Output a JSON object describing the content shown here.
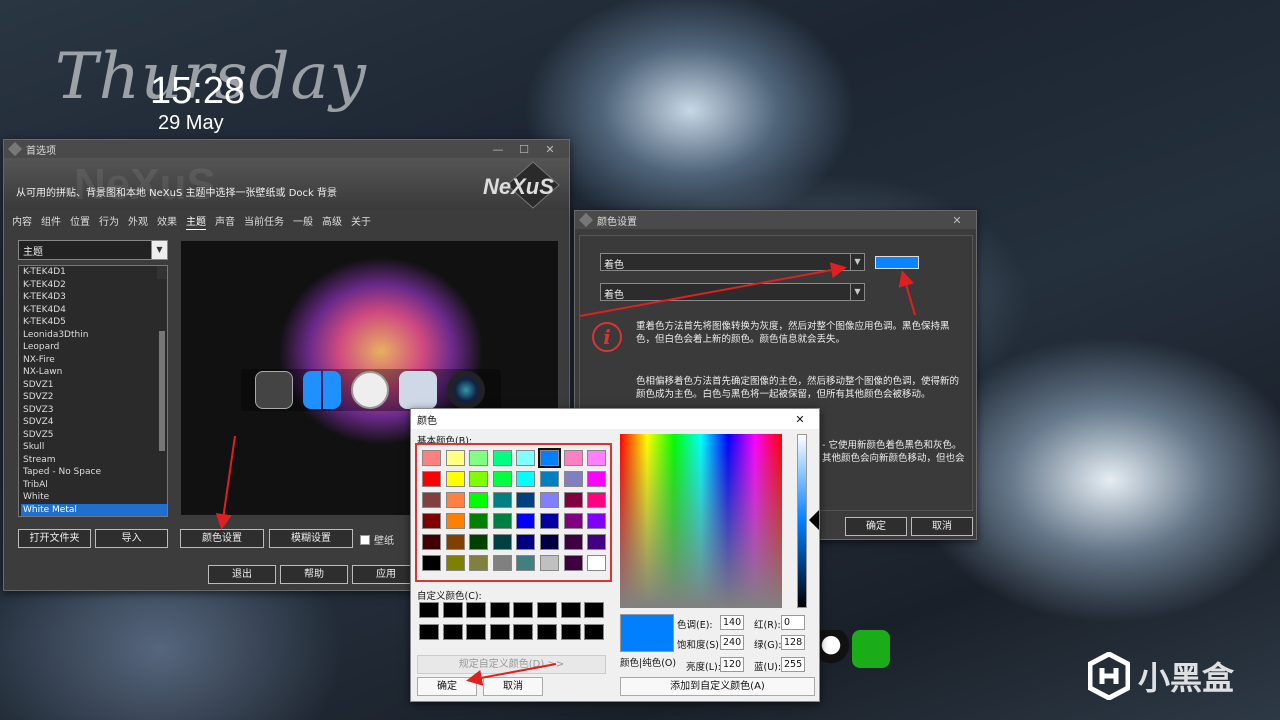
{
  "desktop": {
    "clock_word": "Thursday",
    "time": "15:28",
    "date": "29 May",
    "watermark": "小黑盒"
  },
  "prefs": {
    "title": "首选项",
    "header_bg": "NeXuS",
    "logo": "NeXuS",
    "description": "从可用的拼贴、背景图和本地 NeXuS 主题中选择一张壁纸或 Dock 背景",
    "tabs": [
      "内容",
      "组件",
      "位置",
      "行为",
      "外观",
      "效果",
      "主题",
      "声音",
      "当前任务",
      "一般",
      "高级",
      "关于"
    ],
    "active_tab": "主题",
    "select": "主题",
    "themes": [
      "K-TEK4D1",
      "K-TEK4D2",
      "K-TEK4D3",
      "K-TEK4D4",
      "K-TEK4D5",
      "Leonida3Dthin",
      "Leopard",
      "NX-Fire",
      "NX-Lawn",
      "SDVZ1",
      "SDVZ2",
      "SDVZ3",
      "SDVZ4",
      "SDVZ5",
      "Skull",
      "Stream",
      "Taped - No Space",
      "TribAl",
      "White",
      "White Metal"
    ],
    "selected_theme": "White Metal",
    "buttons": {
      "open_folder": "打开文件夹",
      "import": "导入",
      "color_settings": "颜色设置",
      "blur_settings": "模糊设置",
      "wallpaper": "壁纸"
    },
    "footer": {
      "exit": "退出",
      "help": "帮助",
      "apply": "应用"
    }
  },
  "colorset": {
    "title": "颜色设置",
    "select1": "着色",
    "select2": "着色",
    "swatch": "#0a84ff",
    "text1": "重着色方法首先将图像转换为灰度，然后对整个图像应用色调。黑色保持黑色，但白色会着上新的颜色。颜色信息就会丢失。",
    "text2": "色相偏移着色方法首先确定图像的主色，然后移动整个图像的色调，使得新的颜色成为主色。白色与黑色将一起被保留，但所有其他颜色会被移动。",
    "text3a": "- 它使用新颜色着色黑色和灰色。",
    "text3b": "其他颜色会向新颜色移动，但也会",
    "ok": "确定",
    "cancel": "取消"
  },
  "colordlg": {
    "title": "颜色",
    "basic_label": "基本颜色(B):",
    "custom_label": "自定义颜色(C):",
    "define_custom": "规定自定义颜色(D) >>",
    "ok": "确定",
    "cancel": "取消",
    "add_custom": "添加到自定义颜色(A)",
    "color_solid": "颜色|纯色(O)",
    "hue_label": "色调(E):",
    "hue": "140",
    "sat_label": "饱和度(S):",
    "sat": "240",
    "lum_label": "亮度(L):",
    "lum": "120",
    "red_label": "红(R):",
    "red": "0",
    "green_label": "绿(G):",
    "green": "128",
    "blue_label": "蓝(U):",
    "blue": "255",
    "current_color": "#0080ff",
    "basic_colors": [
      [
        "#ff8080",
        "#ffff80",
        "#80ff80",
        "#00ff80",
        "#80ffff",
        "#0080ff",
        "#ff80c0",
        "#ff80ff"
      ],
      [
        "#ff0000",
        "#ffff00",
        "#80ff00",
        "#00ff40",
        "#00ffff",
        "#0080c0",
        "#8080c0",
        "#ff00ff"
      ],
      [
        "#804040",
        "#ff8040",
        "#00ff00",
        "#008080",
        "#004080",
        "#8080ff",
        "#800040",
        "#ff0080"
      ],
      [
        "#800000",
        "#ff8000",
        "#008000",
        "#008040",
        "#0000ff",
        "#0000a0",
        "#800080",
        "#8000ff"
      ],
      [
        "#400000",
        "#804000",
        "#004000",
        "#004040",
        "#000080",
        "#000040",
        "#400040",
        "#400080"
      ],
      [
        "#000000",
        "#808000",
        "#808040",
        "#808080",
        "#408080",
        "#c0c0c0",
        "#400040",
        "#ffffff"
      ]
    ],
    "selected_basic": "#0080ff"
  }
}
